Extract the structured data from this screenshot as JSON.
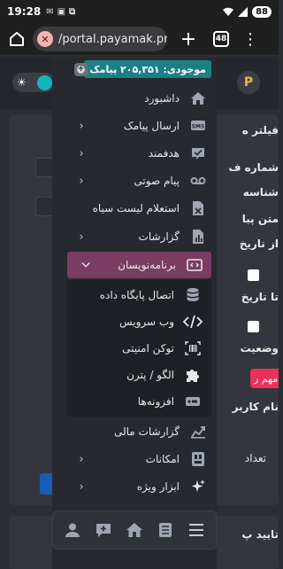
{
  "statusbar": {
    "time": "19:28",
    "battery": "88"
  },
  "browser": {
    "url": "/portal.payamak.pro",
    "tab_count": "48",
    "plus": "+",
    "more": "⋮"
  },
  "page": {
    "filter_label": "فیلتر ه",
    "labels": [
      "شماره ف",
      "شناسه",
      "متن پیا",
      "از تاریخ",
      "تا تاریخ",
      "وضعیت",
      "نام کاربر",
      "تعداد"
    ],
    "chip": "مهم ر",
    "card2_label": "تایید پ"
  },
  "menu": {
    "balance": "موجودی: ۲۰۵,۳۵۱ پیامک",
    "balance_add": "+",
    "items": [
      {
        "label": "داشبورد",
        "icon": "home-icon",
        "chevron": false
      },
      {
        "label": "ارسال پیامک",
        "icon": "sms-icon",
        "chevron": true
      },
      {
        "label": "هدفمند",
        "icon": "targeted-sms-icon",
        "chevron": true
      },
      {
        "label": "پیام صوتی",
        "icon": "voicemail-icon",
        "chevron": true
      },
      {
        "label": "استعلام لیست سیاه",
        "icon": "blacklist-icon",
        "chevron": false
      },
      {
        "label": "گزارشات",
        "icon": "report-icon",
        "chevron": true
      },
      {
        "label": "برنامه‌نویسان",
        "icon": "developer-icon",
        "chevron": true,
        "expanded": true
      },
      {
        "label": "گزارشات مالی",
        "icon": "finance-chart-icon",
        "chevron": false
      },
      {
        "label": "امکانات",
        "icon": "features-icon",
        "chevron": true
      },
      {
        "label": "ابزار ویژه",
        "icon": "sparkle-icon",
        "chevron": true
      }
    ],
    "submenu": [
      {
        "label": "اتصال پایگاه داده",
        "icon": "database-icon"
      },
      {
        "label": "وب سرویس",
        "icon": "code-icon"
      },
      {
        "label": "توکن امنیتی",
        "icon": "barcode-icon"
      },
      {
        "label": "الگو / پترن",
        "icon": "puzzle-icon"
      },
      {
        "label": "افزونه‌ها",
        "icon": "plugin-icon"
      }
    ]
  },
  "colors": {
    "active_item": "#7a3c62",
    "balance_bg": "#1c7f86",
    "toggle_knob": "#15b3b8",
    "chip": "#e8315b"
  }
}
